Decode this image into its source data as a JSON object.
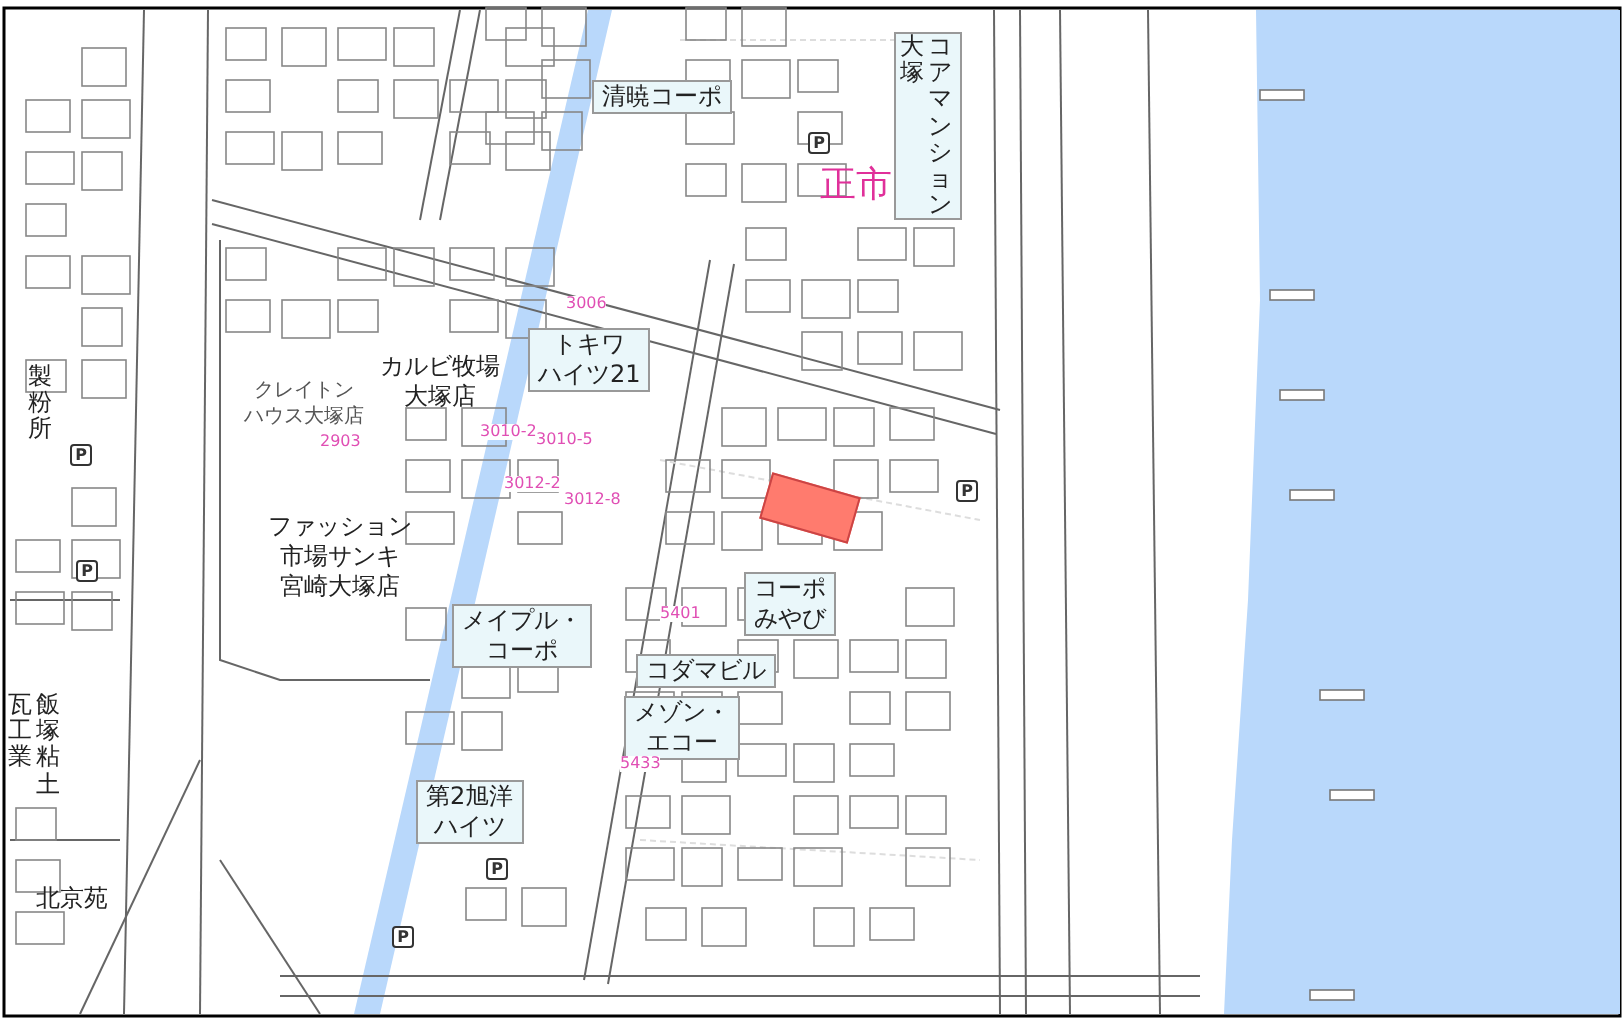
{
  "map": {
    "labels": [
      {
        "kind": "apartment",
        "lines": [
          "清暁コーポ"
        ]
      },
      {
        "kind": "vertical-apartment",
        "lines": [
          "大塚",
          "コアマンション"
        ]
      },
      {
        "kind": "landmark",
        "lines": [
          "正市"
        ]
      },
      {
        "kind": "vertical",
        "lines": [
          "製粉所"
        ]
      },
      {
        "kind": "small",
        "lines": [
          "クレイトン",
          "ハウス大塚店"
        ]
      },
      {
        "kind": "shop",
        "lines": [
          "カルビ牧場",
          "大塚店"
        ]
      },
      {
        "kind": "apartment",
        "lines": [
          "トキワ",
          "ハイツ21"
        ]
      },
      {
        "kind": "shop",
        "lines": [
          "ファッション",
          "市場サンキ",
          "宮崎大塚店"
        ]
      },
      {
        "kind": "apartment",
        "lines": [
          "メイプル・",
          "コーポ"
        ]
      },
      {
        "kind": "apartment",
        "lines": [
          "コーポ",
          "みやび"
        ]
      },
      {
        "kind": "vertical",
        "lines": [
          "瓦工業",
          "飯塚粘土"
        ]
      },
      {
        "kind": "apartment",
        "lines": [
          "コダマビル"
        ]
      },
      {
        "kind": "apartment",
        "lines": [
          "メゾン・",
          "エコー"
        ]
      },
      {
        "kind": "apartment",
        "lines": [
          "第2旭洋",
          "ハイツ"
        ]
      },
      {
        "kind": "shop",
        "lines": [
          "北京苑"
        ]
      }
    ],
    "lot_numbers": [
      "2903",
      "3006",
      "3010-2",
      "3010-5",
      "3012-2",
      "3012-8",
      "5401",
      "5433"
    ],
    "parking_marks": [
      "P",
      "P",
      "P",
      "P",
      "P",
      "P"
    ],
    "highlighted_parcel": {
      "color": "#ff7b6e"
    }
  }
}
